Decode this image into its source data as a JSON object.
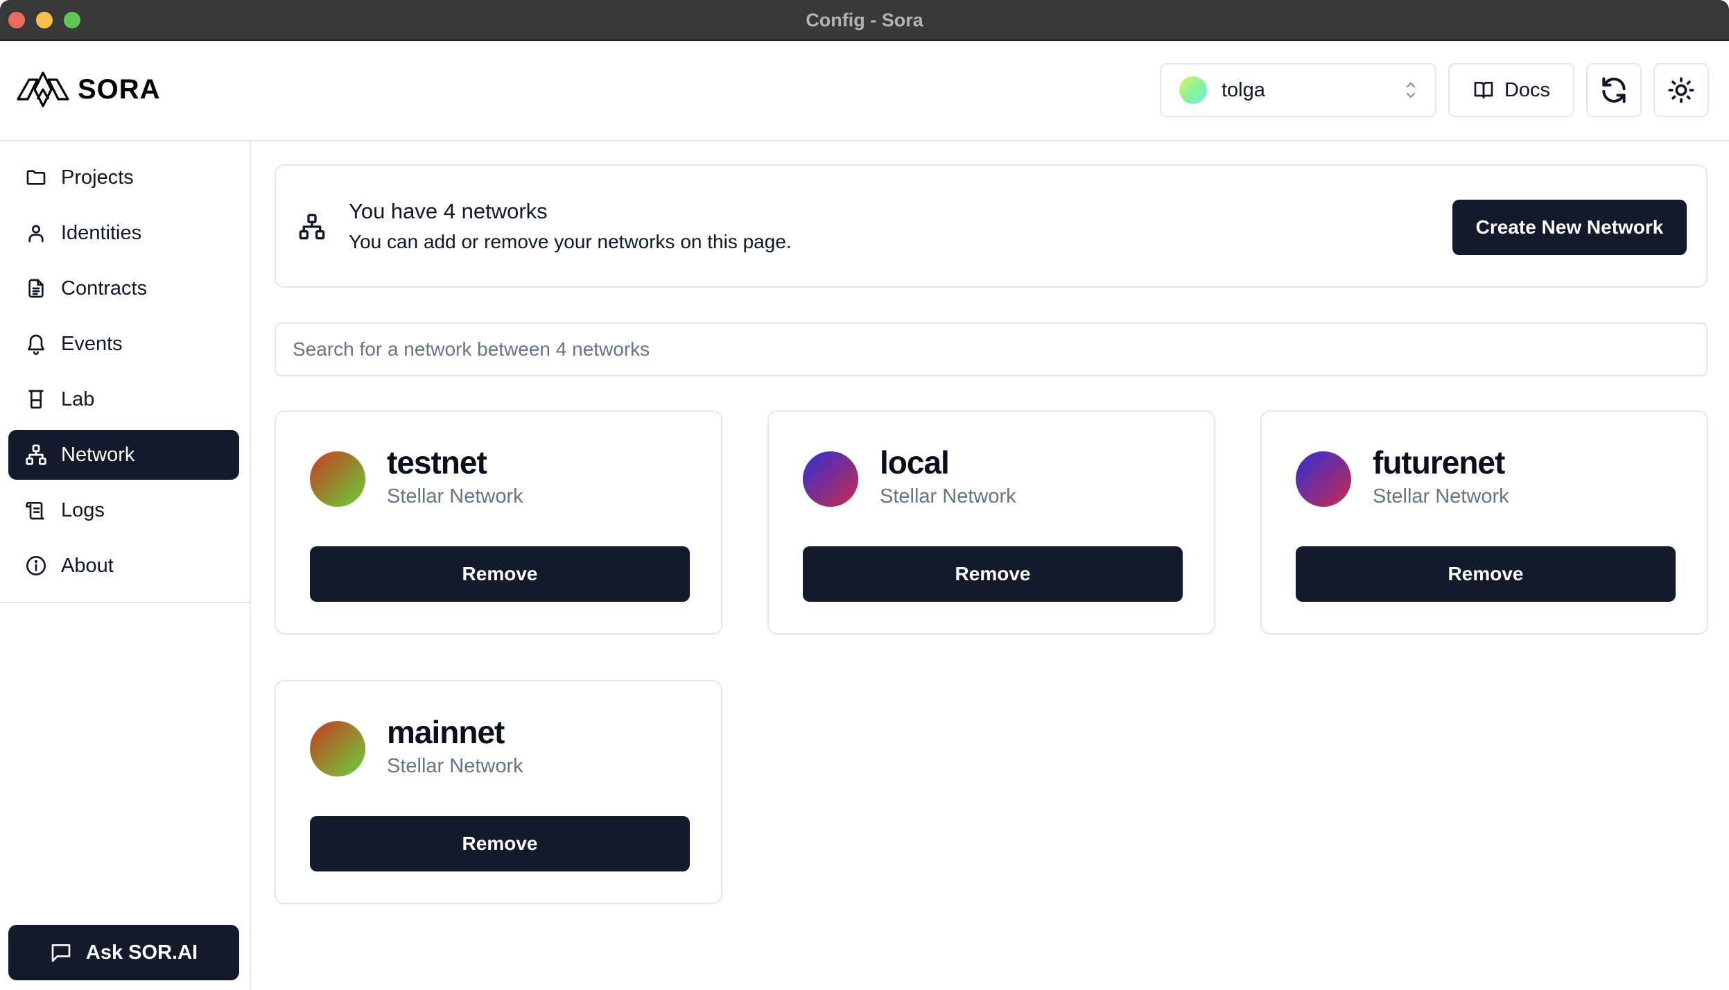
{
  "window": {
    "title": "Config - Sora"
  },
  "header": {
    "logo_text": "SORA",
    "account": {
      "name": "tolga",
      "gradient": [
        "#d9f55a",
        "#6ef0cf"
      ]
    },
    "docs_label": "Docs",
    "refresh_icon": "refresh-icon",
    "theme_icon": "sun-icon"
  },
  "sidebar": {
    "items": [
      {
        "label": "Projects",
        "icon": "folder-icon",
        "active": false
      },
      {
        "label": "Identities",
        "icon": "user-icon",
        "active": false
      },
      {
        "label": "Contracts",
        "icon": "document-icon",
        "active": false
      },
      {
        "label": "Events",
        "icon": "bell-icon",
        "active": false
      },
      {
        "label": "Lab",
        "icon": "beaker-icon",
        "active": false
      },
      {
        "label": "Network",
        "icon": "network-icon",
        "active": true
      },
      {
        "label": "Logs",
        "icon": "scroll-icon",
        "active": false
      },
      {
        "label": "About",
        "icon": "info-icon",
        "active": false
      }
    ],
    "ask_label": "Ask SOR.AI"
  },
  "banner": {
    "title": "You have 4 networks",
    "subtitle": "You can add or remove your networks on this page.",
    "create_label": "Create New Network"
  },
  "search": {
    "placeholder": "Search for a network between 4 networks",
    "value": ""
  },
  "networks": [
    {
      "name": "testnet",
      "type": "Stellar Network",
      "remove_label": "Remove",
      "avatar_gradient": [
        "#c83a22",
        "#66d23c"
      ]
    },
    {
      "name": "local",
      "type": "Stellar Network",
      "remove_label": "Remove",
      "avatar_gradient": [
        "#2f2fd6",
        "#cc2a4c"
      ]
    },
    {
      "name": "futurenet",
      "type": "Stellar Network",
      "remove_label": "Remove",
      "avatar_gradient": [
        "#2f2fd6",
        "#cc2a4c"
      ]
    },
    {
      "name": "mainnet",
      "type": "Stellar Network",
      "remove_label": "Remove",
      "avatar_gradient": [
        "#c83a22",
        "#66d23c"
      ]
    }
  ],
  "colors": {
    "primary": "#131a2b",
    "border": "#e2e8f0",
    "muted_text": "#64748b"
  }
}
